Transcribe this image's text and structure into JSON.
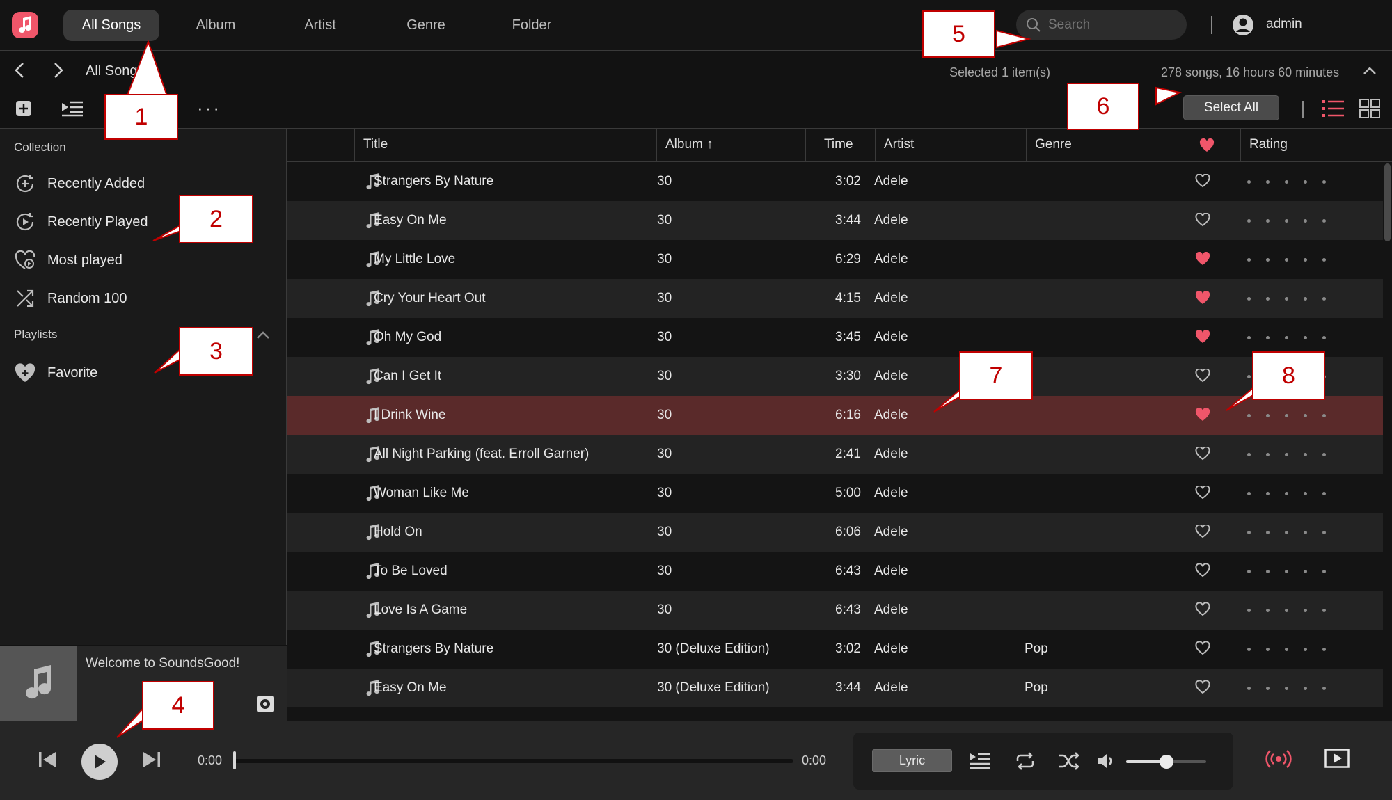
{
  "colors": {
    "accent": "#f0566a",
    "heart": "#f0566a",
    "selected_row": "#5a2a2a",
    "annotation": "#c00000"
  },
  "nav": {
    "logo_icon": "music-note-icon",
    "tabs": [
      {
        "label": "All Songs",
        "active": true
      },
      {
        "label": "Album",
        "active": false
      },
      {
        "label": "Artist",
        "active": false
      },
      {
        "label": "Genre",
        "active": false
      },
      {
        "label": "Folder",
        "active": false
      }
    ],
    "search_placeholder": "Search",
    "user": "admin"
  },
  "breadcrumb": {
    "current": "All Songs",
    "selected_info": "Selected 1 item(s)",
    "songs_info": "278 songs, 16 hours 60 minutes"
  },
  "toolbar": {
    "more_label": "···",
    "select_all_label": "Select All"
  },
  "sidebar": {
    "collection_label": "Collection",
    "collection_items": [
      {
        "label": "Recently Added",
        "icon": "recently-added-icon"
      },
      {
        "label": "Recently Played",
        "icon": "recently-played-icon"
      },
      {
        "label": "Most played",
        "icon": "most-played-icon"
      },
      {
        "label": "Random 100",
        "icon": "shuffle-icon"
      }
    ],
    "playlists_label": "Playlists",
    "playlist_items": [
      {
        "label": "Favorite",
        "icon": "heart-plus-icon"
      }
    ]
  },
  "now_playing": {
    "welcome": "Welcome to SoundsGood!"
  },
  "table": {
    "columns": {
      "title": "Title",
      "album": "Album",
      "album_sort": "↑",
      "time": "Time",
      "artist": "Artist",
      "genre": "Genre",
      "rating": "Rating"
    },
    "rows": [
      {
        "title": "Strangers By Nature",
        "album": "30",
        "time": "3:02",
        "artist": "Adele",
        "genre": "",
        "favorite": false
      },
      {
        "title": "Easy On Me",
        "album": "30",
        "time": "3:44",
        "artist": "Adele",
        "genre": "",
        "favorite": false
      },
      {
        "title": "My Little Love",
        "album": "30",
        "time": "6:29",
        "artist": "Adele",
        "genre": "",
        "favorite": true
      },
      {
        "title": "Cry Your Heart Out",
        "album": "30",
        "time": "4:15",
        "artist": "Adele",
        "genre": "",
        "favorite": true
      },
      {
        "title": "Oh My God",
        "album": "30",
        "time": "3:45",
        "artist": "Adele",
        "genre": "",
        "favorite": true
      },
      {
        "title": "Can I Get It",
        "album": "30",
        "time": "3:30",
        "artist": "Adele",
        "genre": "",
        "favorite": false
      },
      {
        "title": "I Drink Wine",
        "album": "30",
        "time": "6:16",
        "artist": "Adele",
        "genre": "",
        "favorite": true,
        "selected": true
      },
      {
        "title": "All Night Parking (feat. Erroll Garner)",
        "album": "30",
        "time": "2:41",
        "artist": "Adele",
        "genre": "",
        "favorite": false
      },
      {
        "title": "Woman Like Me",
        "album": "30",
        "time": "5:00",
        "artist": "Adele",
        "genre": "",
        "favorite": false
      },
      {
        "title": "Hold On",
        "album": "30",
        "time": "6:06",
        "artist": "Adele",
        "genre": "",
        "favorite": false
      },
      {
        "title": "To Be Loved",
        "album": "30",
        "time": "6:43",
        "artist": "Adele",
        "genre": "",
        "favorite": false
      },
      {
        "title": "Love Is A Game",
        "album": "30",
        "time": "6:43",
        "artist": "Adele",
        "genre": "",
        "favorite": false
      },
      {
        "title": "Strangers By Nature",
        "album": "30 (Deluxe Edition)",
        "time": "3:02",
        "artist": "Adele",
        "genre": "Pop",
        "favorite": false
      },
      {
        "title": "Easy On Me",
        "album": "30 (Deluxe Edition)",
        "time": "3:44",
        "artist": "Adele",
        "genre": "Pop",
        "favorite": false
      }
    ]
  },
  "player": {
    "elapsed": "0:00",
    "duration": "0:00",
    "progress": 0,
    "volume": 0.5,
    "lyric_label": "Lyric"
  },
  "annotations": [
    "1",
    "2",
    "3",
    "4",
    "5",
    "6",
    "7",
    "8"
  ]
}
